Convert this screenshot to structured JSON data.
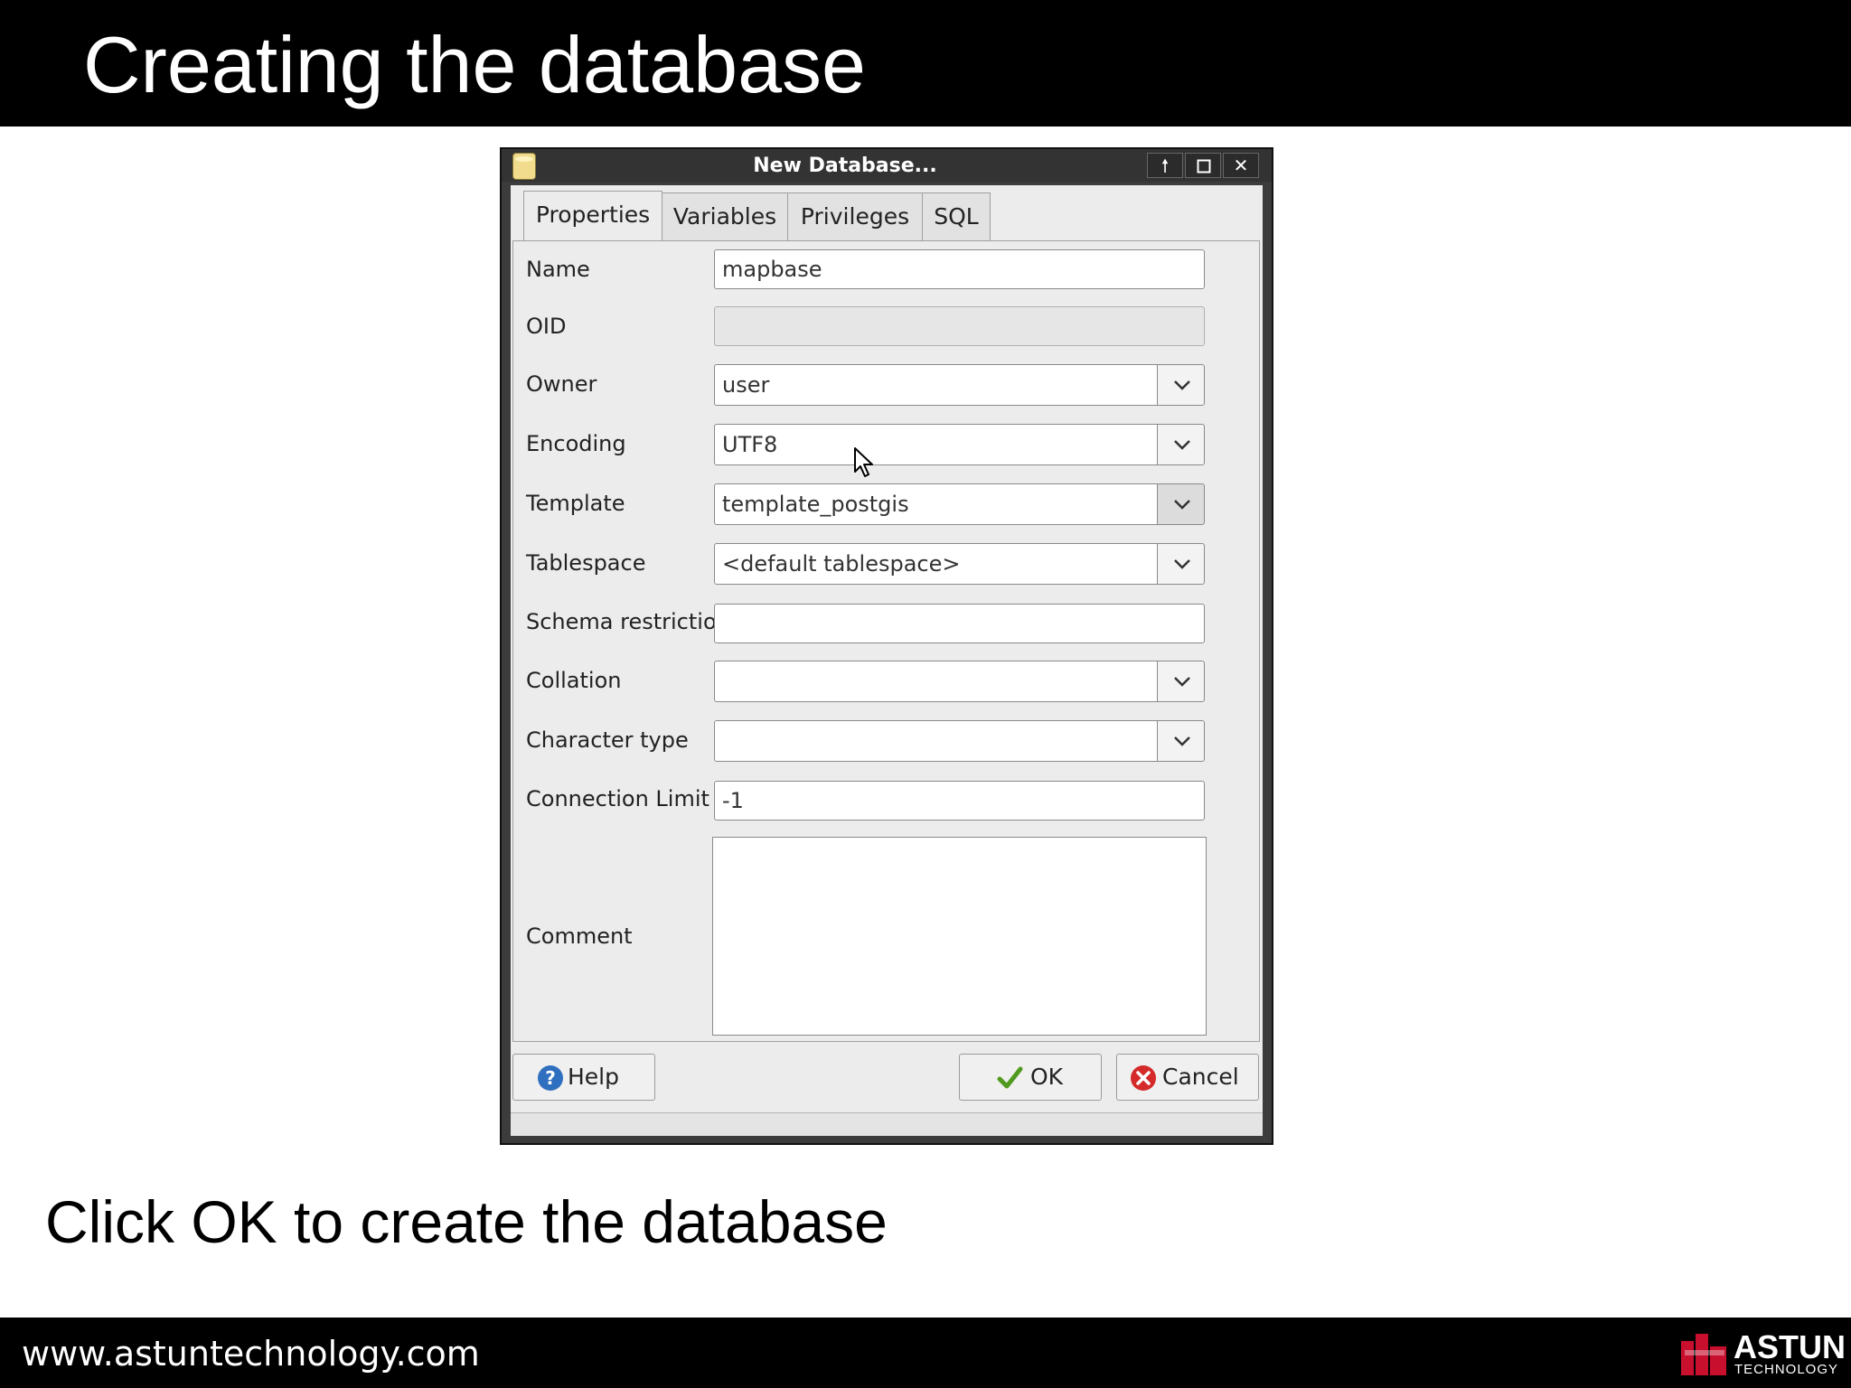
{
  "slide": {
    "title": "Creating the database",
    "instruction": "Click OK to create the database"
  },
  "footer": {
    "url": "www.astuntechnology.com",
    "brand_name": "ASTUN",
    "brand_sub": "TECHNOLOGY"
  },
  "dialog": {
    "title": "New Database...",
    "tabs": [
      {
        "label": "Properties",
        "active": true
      },
      {
        "label": "Variables",
        "active": false
      },
      {
        "label": "Privileges",
        "active": false
      },
      {
        "label": "SQL",
        "active": false
      }
    ],
    "fields": {
      "name": {
        "label": "Name",
        "value": "mapbase"
      },
      "oid": {
        "label": "OID",
        "value": ""
      },
      "owner": {
        "label": "Owner",
        "value": "user"
      },
      "encoding": {
        "label": "Encoding",
        "value": "UTF8"
      },
      "template": {
        "label": "Template",
        "value": "template_postgis"
      },
      "tablespace": {
        "label": "Tablespace",
        "value": "<default tablespace>"
      },
      "schema_restriction": {
        "label": "Schema restriction",
        "value": ""
      },
      "collation": {
        "label": "Collation",
        "value": ""
      },
      "character_type": {
        "label": "Character type",
        "value": ""
      },
      "connection_limit": {
        "label": "Connection Limit",
        "value": "-1"
      },
      "comment": {
        "label": "Comment",
        "value": ""
      }
    },
    "buttons": {
      "help": "Help",
      "ok": "OK",
      "cancel": "Cancel"
    }
  },
  "icons": [
    "database-icon",
    "window-up-icon",
    "maximize-icon",
    "close-icon",
    "chevron-down-icon",
    "help-icon",
    "check-icon",
    "cancel-icon",
    "mouse-cursor-icon"
  ],
  "colors": {
    "slide_bar": "#000000",
    "dialog_bg": "#ececec",
    "help_blue": "#2f6fbf",
    "cancel_red": "#d42a2a",
    "ok_green": "#4f9a1f"
  }
}
